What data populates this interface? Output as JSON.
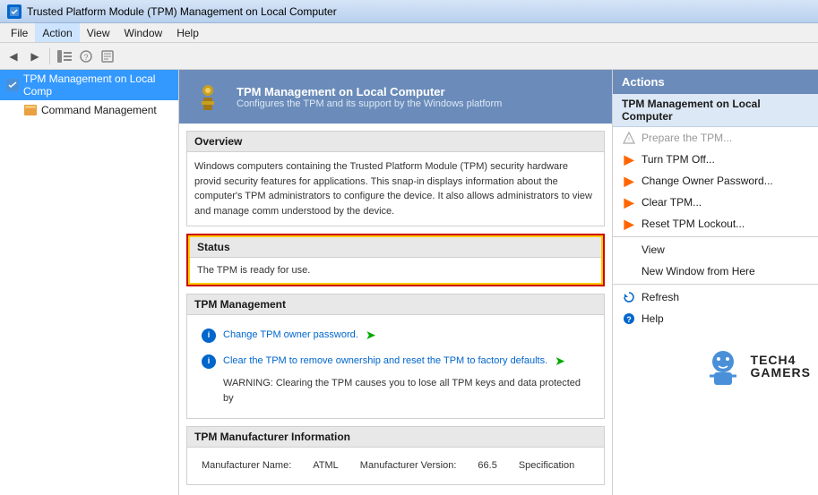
{
  "window": {
    "title": "Trusted Platform Module (TPM) Management on Local Computer"
  },
  "menu": {
    "items": [
      {
        "label": "File",
        "id": "file"
      },
      {
        "label": "Action",
        "id": "action",
        "active": true
      },
      {
        "label": "View",
        "id": "view"
      },
      {
        "label": "Window",
        "id": "window"
      },
      {
        "label": "Help",
        "id": "help"
      }
    ]
  },
  "toolbar": {
    "buttons": [
      {
        "id": "back",
        "icon": "◀",
        "label": "Back"
      },
      {
        "id": "forward",
        "icon": "▶",
        "label": "Forward"
      },
      {
        "id": "up",
        "icon": "📁",
        "label": "Up One Level"
      },
      {
        "id": "help",
        "icon": "❓",
        "label": "Help"
      },
      {
        "id": "export",
        "icon": "📋",
        "label": "Export List"
      }
    ]
  },
  "tree": {
    "items": [
      {
        "id": "tpm-root",
        "label": "TPM Management on Local Comp",
        "level": 0,
        "selected": true,
        "icon": "🔐"
      },
      {
        "id": "command-mgmt",
        "label": "Command Management",
        "level": 1,
        "icon": "🗂️"
      }
    ]
  },
  "content": {
    "header": {
      "title": "TPM Management on Local Computer",
      "subtitle": "Configures the TPM and its support by the Windows platform",
      "icon": "🔑"
    },
    "overview": {
      "title": "Overview",
      "text": "Windows computers containing the Trusted Platform Module (TPM) security hardware provid security features for applications. This snap-in displays information about the computer's TPM administrators to configure the device. It also allows administrators to view and manage comm understood by the device."
    },
    "status": {
      "title": "Status",
      "text": "The TPM is ready for use."
    },
    "tpm_management": {
      "title": "TPM Management",
      "items": [
        {
          "id": "change-owner-pwd",
          "text": "Change TPM owner password.",
          "has_arrow": true
        },
        {
          "id": "clear-tpm",
          "text": "Clear the TPM to remove ownership and reset the TPM to factory defaults.",
          "has_arrow": true
        }
      ],
      "warning": "WARNING: Clearing the TPM causes you to lose all TPM keys and data protected by"
    },
    "manufacturer": {
      "title": "TPM Manufacturer Information",
      "fields": [
        {
          "label": "Manufacturer Name:",
          "value": "ATML"
        },
        {
          "label": "Manufacturer Version:",
          "value": "66.5"
        },
        {
          "label": "Specification",
          "value": ""
        }
      ]
    }
  },
  "actions": {
    "header": "Actions",
    "section_title": "TPM Management on Local Computer",
    "items": [
      {
        "id": "prepare-tpm",
        "label": "Prepare the TPM...",
        "has_icon": true,
        "disabled": true
      },
      {
        "id": "turn-tpm-off",
        "label": "Turn TPM Off...",
        "has_icon": true,
        "disabled": false
      },
      {
        "id": "change-owner-pwd",
        "label": "Change Owner Password...",
        "has_icon": true,
        "disabled": false
      },
      {
        "id": "clear-tpm",
        "label": "Clear TPM...",
        "has_icon": true,
        "disabled": false
      },
      {
        "id": "reset-lockout",
        "label": "Reset TPM Lockout...",
        "has_icon": true,
        "disabled": false
      },
      {
        "id": "view",
        "label": "View",
        "has_icon": false,
        "disabled": false
      },
      {
        "id": "new-window",
        "label": "New Window from Here",
        "has_icon": false,
        "disabled": false
      },
      {
        "id": "refresh",
        "label": "Refresh",
        "has_icon": true,
        "disabled": false
      },
      {
        "id": "help",
        "label": "Help",
        "has_icon": true,
        "disabled": false
      }
    ]
  },
  "logo": {
    "text": "TECH4GAMERS"
  }
}
